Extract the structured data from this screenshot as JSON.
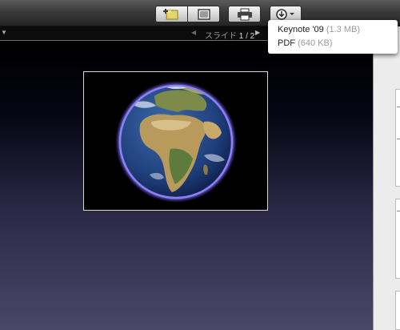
{
  "toolbar": {
    "buttons": [
      {
        "name": "add-slide",
        "icon": "add-folder-icon"
      },
      {
        "name": "slide-view",
        "icon": "slide-icon"
      },
      {
        "name": "print",
        "icon": "printer-icon"
      },
      {
        "name": "download",
        "icon": "download-icon"
      }
    ]
  },
  "navbar": {
    "label": "スライド",
    "page": "1 / 2"
  },
  "dropdown": {
    "items": [
      {
        "label": "Keynote '09",
        "size": "(1.3 MB)"
      },
      {
        "label": "PDF",
        "size": "(640 KB)"
      }
    ]
  },
  "colors": {
    "accent_globe_halo": "#7a6cf0",
    "dropdown_bg": "#ffffff",
    "size_text": "#9a9a9a"
  }
}
